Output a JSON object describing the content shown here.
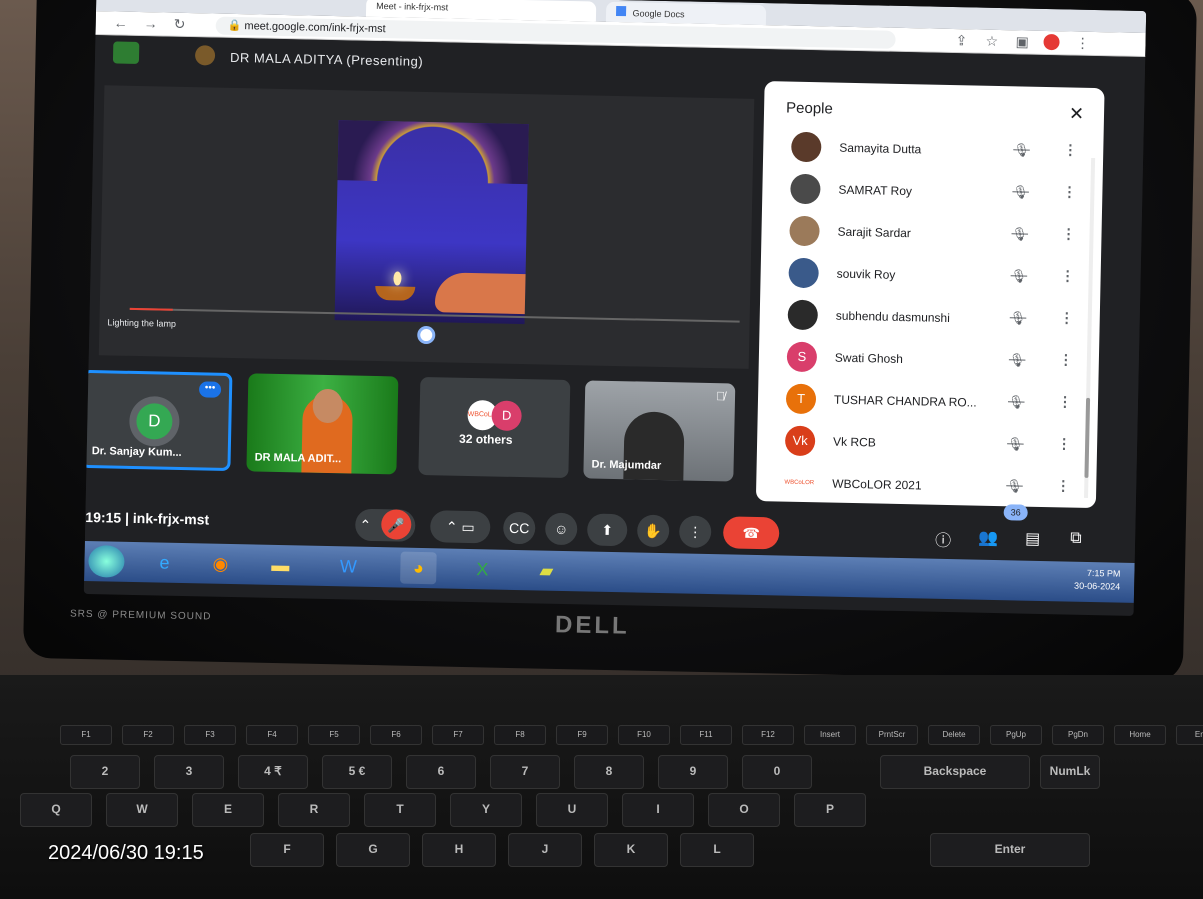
{
  "browser": {
    "tabs": [
      {
        "label": "Meet - ink-frjx-mst"
      },
      {
        "label": "Google Docs"
      }
    ],
    "url": "meet.google.com/ink-frjx-mst"
  },
  "meet": {
    "presenter_label": "DR MALA ADITYA (Presenting)",
    "shared_video": {
      "caption": "Lighting the lamp",
      "progress": 0.07
    },
    "tiles": [
      {
        "name": "Dr. Sanjay Kum...",
        "avatar_letter": "D",
        "more": "•••"
      },
      {
        "name": "DR MALA ADIT..."
      },
      {
        "name": "32 others",
        "avatar_letter": "D",
        "avatar_logo": "WBCoLOR"
      },
      {
        "name": "Dr. Majumdar"
      }
    ],
    "meeting_time": "19:15",
    "meeting_code": "ink-frjx-mst",
    "people_count": "36"
  },
  "people_panel": {
    "title": "People",
    "participants": [
      {
        "name": "Samayita Dutta",
        "avatar_color": "#5a3a2a"
      },
      {
        "name": "SAMRAT Roy",
        "avatar_color": "#4a4a4a"
      },
      {
        "name": "Sarajit Sardar",
        "avatar_color": "#9b7a5a"
      },
      {
        "name": "souvik Roy",
        "avatar_color": "#3a5a8a"
      },
      {
        "name": "subhendu dasmunshi",
        "avatar_color": "#2a2a2a"
      },
      {
        "name": "Swati Ghosh",
        "avatar_letter": "S",
        "avatar_color": "#d93e6b"
      },
      {
        "name": "TUSHAR CHANDRA RO...",
        "avatar_letter": "T",
        "avatar_color": "#e8710a"
      },
      {
        "name": "Vk RCB",
        "avatar_letter": "Vk",
        "avatar_color": "#d93e1a"
      },
      {
        "name": "WBCoLOR 2021",
        "avatar_logo": "WBCoLOR",
        "avatar_color": "#ffffff"
      }
    ]
  },
  "taskbar": {
    "time": "7:15 PM",
    "date": "30-06-2024"
  },
  "laptop": {
    "brand": "DELL",
    "speaker_label": "SRS @ PREMIUM SOUND"
  },
  "keyboard": {
    "row1": [
      "Q",
      "W",
      "E",
      "R",
      "T",
      "Y",
      "U",
      "I",
      "O",
      "P"
    ],
    "row_num": [
      "2",
      "3",
      "4 ₹",
      "5 €",
      "6",
      "7",
      "8",
      "9",
      "0"
    ],
    "backspace": "Backspace",
    "enter": "Enter",
    "numlk": "NumLk",
    "fkeys": [
      "F1",
      "F2",
      "F3",
      "F4",
      "F5",
      "F6",
      "F7",
      "F8",
      "F9",
      "F10",
      "F11",
      "F12",
      "Insert",
      "PrntScr",
      "Delete",
      "PgUp",
      "PgDn",
      "Home",
      "End"
    ],
    "row_home": [
      "F",
      "G",
      "H",
      "J",
      "K",
      "L"
    ]
  },
  "camera_timestamp": "2024/06/30 19:15"
}
